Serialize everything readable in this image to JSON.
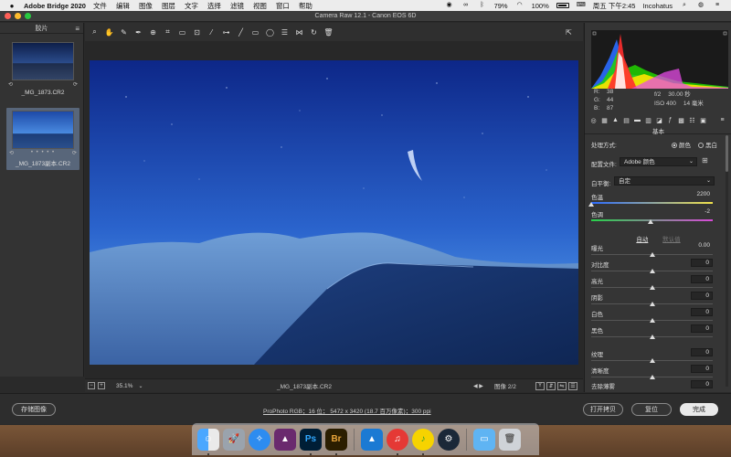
{
  "menubar": {
    "app_name": "Adobe Bridge 2020",
    "items": [
      "文件",
      "编辑",
      "图像",
      "图层",
      "文字",
      "选择",
      "滤镜",
      "视图",
      "窗口",
      "帮助"
    ],
    "battery": "79%",
    "wifi_pct": "100%",
    "datetime": "周五 下午2:45",
    "user": "Incohatus"
  },
  "window": {
    "title": "Camera Raw 12.1  -  Canon EOS 6D"
  },
  "filmstrip": {
    "header": "胶片",
    "items": [
      {
        "name": "_MG_1873.CR2",
        "selected": false
      },
      {
        "name": "_MG_1873副本.CR2",
        "selected": true,
        "stars": "• • • • •"
      }
    ]
  },
  "toolbar": {
    "icons": [
      "zoom-icon",
      "hand-icon",
      "white-balance-icon",
      "color-sampler-icon",
      "targeted-adjust-icon",
      "crop-icon",
      "straighten-icon",
      "transform-icon",
      "spot-removal-icon",
      "red-eye-icon",
      "adjustment-brush-icon",
      "graduated-filter-icon",
      "radial-filter-icon",
      "presets-icon",
      "rotate-ccw-icon",
      "rotate-cw-icon",
      "trash-icon"
    ]
  },
  "preview_footer": {
    "zoom": "35.1%",
    "file_name": "_MG_1873副本.CR2",
    "image_count": "图像 2/2"
  },
  "readout": {
    "r_label": "R:",
    "r": "38",
    "g_label": "G:",
    "g": "44",
    "b_label": "B:",
    "b": "87",
    "aperture": "f/2",
    "shutter": "30.00 秒",
    "iso": "ISO 400",
    "focal": "14 毫米"
  },
  "panel": {
    "section_title": "基本",
    "treatment_label": "处理方式:",
    "treatment_color": "颜色",
    "treatment_bw": "黑白",
    "profile_label": "配置文件:",
    "profile_value": "Adobe 颜色",
    "wb_label": "白平衡:",
    "wb_value": "自定",
    "auto": "自动",
    "default": "默认值",
    "sliders": {
      "temp": {
        "label": "色温",
        "value": "2200",
        "position": 0.0
      },
      "tint": {
        "label": "色调",
        "value": "-2",
        "position": 0.49
      },
      "exposure": {
        "label": "曝光",
        "value": "0.00",
        "position": 0.5
      },
      "contrast": {
        "label": "对比度",
        "value": "0",
        "position": 0.5
      },
      "highlights": {
        "label": "高光",
        "value": "0",
        "position": 0.5
      },
      "shadows": {
        "label": "阴影",
        "value": "0",
        "position": 0.5
      },
      "whites": {
        "label": "白色",
        "value": "0",
        "position": 0.5
      },
      "blacks": {
        "label": "黑色",
        "value": "0",
        "position": 0.5
      },
      "texture": {
        "label": "纹理",
        "value": "0",
        "position": 0.5
      },
      "clarity": {
        "label": "清晰度",
        "value": "0",
        "position": 0.5
      },
      "dehaze": {
        "label": "去除薄雾",
        "value": "0",
        "position": 0.5
      }
    }
  },
  "bottombar": {
    "save": "存储图像",
    "workflow": "ProPhoto RGB；16 位；  5472 x 3420 (18.7 百万像素)；300 ppi",
    "open_copy": "打开拷贝",
    "reset": "复位",
    "done": "完成"
  },
  "dock": {
    "ps_label": "Ps",
    "br_label": "Br"
  },
  "colors": {
    "accent": "#4a6ea8",
    "sky_top": "#0f2a8a",
    "sky_bottom": "#3f7ed6"
  }
}
